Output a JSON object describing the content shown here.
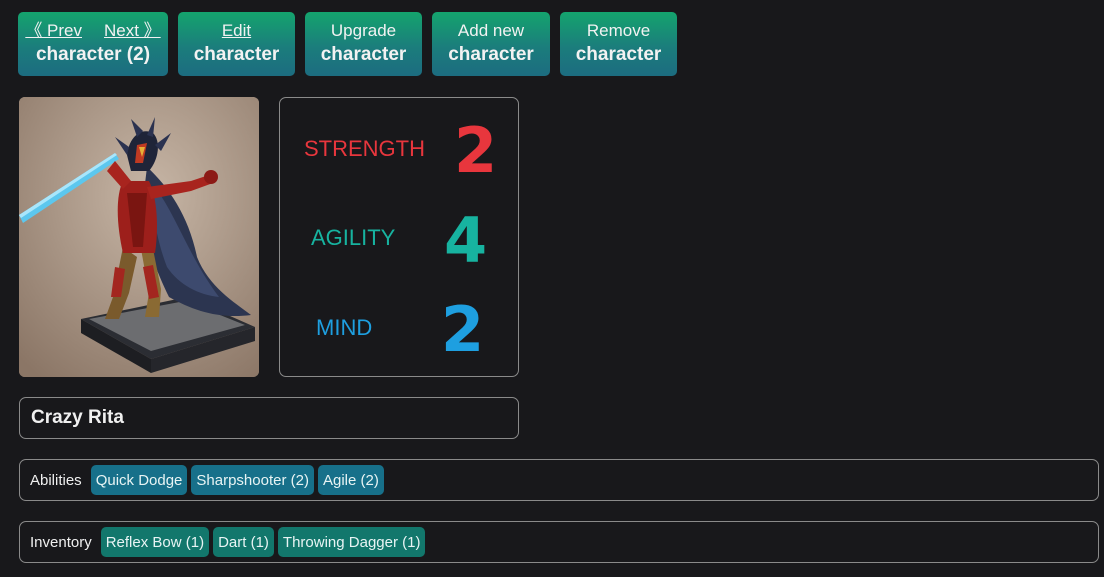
{
  "toolbar": {
    "nav": {
      "prev_label": "《 Prev",
      "next_label": "Next 》",
      "bottom_label": "character (2)"
    },
    "edit": {
      "top": "Edit",
      "bottom": "character"
    },
    "upgrade": {
      "top": "Upgrade",
      "bottom": "character"
    },
    "add": {
      "top": "Add new",
      "bottom": "character"
    },
    "remove": {
      "top": "Remove",
      "bottom": "character"
    }
  },
  "stats": {
    "strength": {
      "label": "STRENGTH",
      "value": "2",
      "color": "#e8363d"
    },
    "agility": {
      "label": "AGILITY",
      "value": "4",
      "color": "#17b3a0"
    },
    "mind": {
      "label": "MIND",
      "value": "2",
      "color": "#1e9fe0"
    }
  },
  "character": {
    "name": "Crazy Rita"
  },
  "abilities": {
    "caption": "Abilities",
    "items": [
      "Quick Dodge",
      "Sharpshooter (2)",
      "Agile (2)"
    ]
  },
  "inventory": {
    "caption": "Inventory",
    "items": [
      "Reflex Bow (1)",
      "Dart (1)",
      "Throwing Dagger (1)"
    ]
  },
  "colors": {
    "background": "#18181b",
    "button_gradient_top": "#14a46d",
    "button_gradient_bottom": "#1c6c80",
    "ability_tag": "#17708a",
    "inventory_tag": "#12776c"
  }
}
